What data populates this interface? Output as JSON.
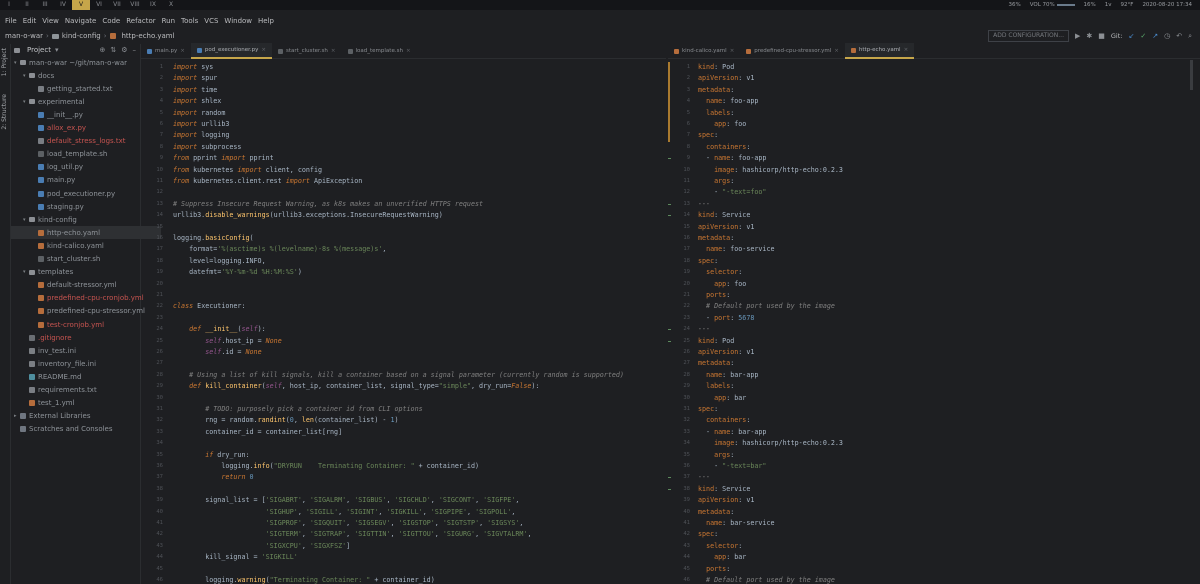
{
  "workspaces": [
    "I",
    "II",
    "III",
    "IV",
    "V",
    "VI",
    "VII",
    "VIII",
    "IX",
    "X"
  ],
  "active_workspace": 4,
  "status": [
    "36%",
    "VOL 70%",
    "16%",
    "1v",
    "92°F",
    "2020-08-20 17:34"
  ],
  "menu": [
    "File",
    "Edit",
    "View",
    "Navigate",
    "Code",
    "Refactor",
    "Run",
    "Tools",
    "VCS",
    "Window",
    "Help"
  ],
  "breadcrumb": [
    "man-o-war",
    "kind-config",
    "http-echo.yaml"
  ],
  "run_config": "ADD CONFIGURATION...",
  "git_label": "Git:",
  "side_tabs": [
    "1: Project",
    "2: Structure"
  ],
  "project_title": "Project",
  "tree": [
    {
      "label": "man-o-war ~/git/man-o-war",
      "depth": 0,
      "type": "folder",
      "open": true
    },
    {
      "label": "docs",
      "depth": 1,
      "type": "folder",
      "open": true
    },
    {
      "label": "getting_started.txt",
      "depth": 2,
      "type": "txt"
    },
    {
      "label": "experimental",
      "depth": 1,
      "type": "folder",
      "open": true
    },
    {
      "label": "__init__.py",
      "depth": 2,
      "type": "py"
    },
    {
      "label": "allox_ex.py",
      "depth": 2,
      "type": "py",
      "red": true
    },
    {
      "label": "default_stress_logs.txt",
      "depth": 2,
      "type": "txt",
      "red": true
    },
    {
      "label": "load_template.sh",
      "depth": 2,
      "type": "sh"
    },
    {
      "label": "log_util.py",
      "depth": 2,
      "type": "py"
    },
    {
      "label": "main.py",
      "depth": 2,
      "type": "py"
    },
    {
      "label": "pod_executioner.py",
      "depth": 2,
      "type": "py"
    },
    {
      "label": "staging.py",
      "depth": 2,
      "type": "py"
    },
    {
      "label": "kind-config",
      "depth": 1,
      "type": "folder",
      "open": true
    },
    {
      "label": "http-echo.yaml",
      "depth": 2,
      "type": "yaml",
      "selected": true
    },
    {
      "label": "kind-calico.yaml",
      "depth": 2,
      "type": "yaml"
    },
    {
      "label": "start_cluster.sh",
      "depth": 2,
      "type": "sh"
    },
    {
      "label": "templates",
      "depth": 1,
      "type": "folder",
      "open": true
    },
    {
      "label": "default-stressor.yml",
      "depth": 2,
      "type": "yaml"
    },
    {
      "label": "predefined-cpu-cronjob.yml",
      "depth": 2,
      "type": "yaml",
      "red": true
    },
    {
      "label": "predefined-cpu-stressor.yml",
      "depth": 2,
      "type": "yaml"
    },
    {
      "label": "test-cronjob.yml",
      "depth": 2,
      "type": "yaml",
      "red": true
    },
    {
      "label": ".gitignore",
      "depth": 1,
      "type": "ignore",
      "red": true
    },
    {
      "label": "inv_test.ini",
      "depth": 1,
      "type": "ini"
    },
    {
      "label": "inventory_file.ini",
      "depth": 1,
      "type": "ini"
    },
    {
      "label": "README.md",
      "depth": 1,
      "type": "md"
    },
    {
      "label": "requirements.txt",
      "depth": 1,
      "type": "txt"
    },
    {
      "label": "test_1.yml",
      "depth": 1,
      "type": "yaml"
    },
    {
      "label": "External Libraries",
      "depth": 0,
      "type": "lib",
      "closed": true
    },
    {
      "label": "Scratches and Consoles",
      "depth": 0,
      "type": "lib"
    }
  ],
  "left_tabs": [
    "main.py",
    "pod_executioner.py",
    "start_cluster.sh",
    "load_template.sh"
  ],
  "left_active_tab": 1,
  "right_tabs": [
    "kind-calico.yaml",
    "predefined-cpu-stressor.yml",
    "http-echo.yaml"
  ],
  "right_active_tab": 2,
  "python_code": [
    [
      [
        "kw",
        "import"
      ],
      [
        "t",
        " sys"
      ]
    ],
    [
      [
        "kw",
        "import"
      ],
      [
        "t",
        " spur"
      ]
    ],
    [
      [
        "kw",
        "import"
      ],
      [
        "t",
        " time"
      ]
    ],
    [
      [
        "kw",
        "import"
      ],
      [
        "t",
        " shlex"
      ]
    ],
    [
      [
        "kw",
        "import"
      ],
      [
        "t",
        " random"
      ]
    ],
    [
      [
        "kw",
        "import"
      ],
      [
        "t",
        " urllib3"
      ]
    ],
    [
      [
        "kw",
        "import"
      ],
      [
        "t",
        " logging"
      ]
    ],
    [
      [
        "kw",
        "import"
      ],
      [
        "t",
        " subprocess"
      ]
    ],
    [
      [
        "kw",
        "from"
      ],
      [
        "t",
        " pprint "
      ],
      [
        "kw",
        "import"
      ],
      [
        "t",
        " pprint"
      ]
    ],
    [
      [
        "kw",
        "from"
      ],
      [
        "t",
        " kubernetes "
      ],
      [
        "kw",
        "import"
      ],
      [
        "t",
        " client, config"
      ]
    ],
    [
      [
        "kw",
        "from"
      ],
      [
        "t",
        " kubernetes.client.rest "
      ],
      [
        "kw",
        "import"
      ],
      [
        "t",
        " ApiException"
      ]
    ],
    [],
    [
      [
        "cmt",
        "# Suppress Insecure Request Warning, as k8s makes an unverified HTTPS request"
      ]
    ],
    [
      [
        "t",
        "urllib3."
      ],
      [
        "fn",
        "disable_warnings"
      ],
      [
        "t",
        "(urllib3.exceptions.InsecureRequestWarning)"
      ]
    ],
    [],
    [
      [
        "t",
        "logging."
      ],
      [
        "fn",
        "basicConfig"
      ],
      [
        "t",
        "("
      ]
    ],
    [
      [
        "t",
        "    format="
      ],
      [
        "str",
        "'%(asctime)s %(levelname)-8s %(message)s'"
      ],
      [
        "t",
        ","
      ]
    ],
    [
      [
        "t",
        "    level=logging.INFO,"
      ]
    ],
    [
      [
        "t",
        "    datefmt="
      ],
      [
        "str",
        "'%Y-%m-%d %H:%M:%S'"
      ],
      [
        "t",
        ")"
      ]
    ],
    [],
    [],
    [
      [
        "kw",
        "class"
      ],
      [
        "t",
        " Executioner:"
      ]
    ],
    [],
    [
      [
        "t",
        "    "
      ],
      [
        "kw",
        "def"
      ],
      [
        "t",
        " "
      ],
      [
        "fn",
        "__init__"
      ],
      [
        "t",
        "("
      ],
      [
        "self",
        "self"
      ],
      [
        "t",
        "):"
      ]
    ],
    [
      [
        "t",
        "        "
      ],
      [
        "self",
        "self"
      ],
      [
        "t",
        ".host_ip = "
      ],
      [
        "kw",
        "None"
      ]
    ],
    [
      [
        "t",
        "        "
      ],
      [
        "self",
        "self"
      ],
      [
        "t",
        ".id = "
      ],
      [
        "kw",
        "None"
      ]
    ],
    [],
    [
      [
        "cmt",
        "    # Using a list of kill signals, kill a container based on a signal parameter (currently random is supported)"
      ]
    ],
    [
      [
        "t",
        "    "
      ],
      [
        "kw",
        "def"
      ],
      [
        "t",
        " "
      ],
      [
        "fn",
        "kill_container"
      ],
      [
        "t",
        "("
      ],
      [
        "self",
        "self"
      ],
      [
        "t",
        ", host_ip, container_list, signal_type="
      ],
      [
        "str",
        "\"simple\""
      ],
      [
        "t",
        ", dry_run="
      ],
      [
        "kw",
        "False"
      ],
      [
        "t",
        "):"
      ]
    ],
    [],
    [
      [
        "cmt",
        "        # TODO: purposely pick a container id from CLI options"
      ]
    ],
    [
      [
        "t",
        "        rng = random."
      ],
      [
        "fn",
        "randint"
      ],
      [
        "t",
        "("
      ],
      [
        "num",
        "0"
      ],
      [
        "t",
        ", "
      ],
      [
        "fn",
        "len"
      ],
      [
        "t",
        "(container_list) - "
      ],
      [
        "num",
        "1"
      ],
      [
        "t",
        ")"
      ]
    ],
    [
      [
        "t",
        "        container_id = container_list[rng]"
      ]
    ],
    [],
    [
      [
        "t",
        "        "
      ],
      [
        "kw",
        "if"
      ],
      [
        "t",
        " dry_run:"
      ]
    ],
    [
      [
        "t",
        "            logging."
      ],
      [
        "fn",
        "info"
      ],
      [
        "t",
        "("
      ],
      [
        "str",
        "\"DRYRUN    Terminating Container: \""
      ],
      [
        "t",
        " + container_id)"
      ]
    ],
    [
      [
        "t",
        "            "
      ],
      [
        "kw",
        "return"
      ],
      [
        "t",
        " "
      ],
      [
        "num",
        "0"
      ]
    ],
    [],
    [
      [
        "t",
        "        signal_list = ["
      ],
      [
        "str",
        "'SIGABRT'"
      ],
      [
        "t",
        ", "
      ],
      [
        "str",
        "'SIGALRM'"
      ],
      [
        "t",
        ", "
      ],
      [
        "str",
        "'SIGBUS'"
      ],
      [
        "t",
        ", "
      ],
      [
        "str",
        "'SIGCHLD'"
      ],
      [
        "t",
        ", "
      ],
      [
        "str",
        "'SIGCONT'"
      ],
      [
        "t",
        ", "
      ],
      [
        "str",
        "'SIGFPE'"
      ],
      [
        "t",
        ","
      ]
    ],
    [
      [
        "t",
        "                       "
      ],
      [
        "str",
        "'SIGHUP'"
      ],
      [
        "t",
        ", "
      ],
      [
        "str",
        "'SIGILL'"
      ],
      [
        "t",
        ", "
      ],
      [
        "str",
        "'SIGINT'"
      ],
      [
        "t",
        ", "
      ],
      [
        "str",
        "'SIGKILL'"
      ],
      [
        "t",
        ", "
      ],
      [
        "str",
        "'SIGPIPE'"
      ],
      [
        "t",
        ", "
      ],
      [
        "str",
        "'SIGPOLL'"
      ],
      [
        "t",
        ","
      ]
    ],
    [
      [
        "t",
        "                       "
      ],
      [
        "str",
        "'SIGPROF'"
      ],
      [
        "t",
        ", "
      ],
      [
        "str",
        "'SIGQUIT'"
      ],
      [
        "t",
        ", "
      ],
      [
        "str",
        "'SIGSEGV'"
      ],
      [
        "t",
        ", "
      ],
      [
        "str",
        "'SIGSTOP'"
      ],
      [
        "t",
        ", "
      ],
      [
        "str",
        "'SIGTSTP'"
      ],
      [
        "t",
        ", "
      ],
      [
        "str",
        "'SIGSYS'"
      ],
      [
        "t",
        ","
      ]
    ],
    [
      [
        "t",
        "                       "
      ],
      [
        "str",
        "'SIGTERM'"
      ],
      [
        "t",
        ", "
      ],
      [
        "str",
        "'SIGTRAP'"
      ],
      [
        "t",
        ", "
      ],
      [
        "str",
        "'SIGTTIN'"
      ],
      [
        "t",
        ", "
      ],
      [
        "str",
        "'SIGTTOU'"
      ],
      [
        "t",
        ", "
      ],
      [
        "str",
        "'SIGURG'"
      ],
      [
        "t",
        ", "
      ],
      [
        "str",
        "'SIGVTALRM'"
      ],
      [
        "t",
        ","
      ]
    ],
    [
      [
        "t",
        "                       "
      ],
      [
        "str",
        "'SIGXCPU'"
      ],
      [
        "t",
        ", "
      ],
      [
        "str",
        "'SIGXFSZ'"
      ],
      [
        "t",
        "]"
      ]
    ],
    [
      [
        "t",
        "        kill_signal = "
      ],
      [
        "str",
        "'SIGKILL'"
      ]
    ],
    [],
    [
      [
        "t",
        "        logging."
      ],
      [
        "fn",
        "warning"
      ],
      [
        "t",
        "("
      ],
      [
        "str",
        "\"Terminating Container: \""
      ],
      [
        "t",
        " + container_id)"
      ]
    ]
  ],
  "yaml_code": [
    [
      [
        "yk",
        "kind"
      ],
      [
        "yv",
        ": Pod"
      ]
    ],
    [
      [
        "yk",
        "apiVersion"
      ],
      [
        "yv",
        ": v1"
      ]
    ],
    [
      [
        "yk",
        "metadata"
      ],
      [
        "yv",
        ":"
      ]
    ],
    [
      [
        "yv",
        "  "
      ],
      [
        "yk",
        "name"
      ],
      [
        "yv",
        ": foo-app"
      ]
    ],
    [
      [
        "yv",
        "  "
      ],
      [
        "yk",
        "labels"
      ],
      [
        "yv",
        ":"
      ]
    ],
    [
      [
        "yv",
        "    "
      ],
      [
        "yk",
        "app"
      ],
      [
        "yv",
        ": foo"
      ]
    ],
    [
      [
        "yk",
        "spec"
      ],
      [
        "yv",
        ":"
      ]
    ],
    [
      [
        "yv",
        "  "
      ],
      [
        "yk",
        "containers"
      ],
      [
        "yv",
        ":"
      ]
    ],
    [
      [
        "yv",
        "  - "
      ],
      [
        "yk",
        "name"
      ],
      [
        "yv",
        ": foo-app"
      ]
    ],
    [
      [
        "yv",
        "    "
      ],
      [
        "yk",
        "image"
      ],
      [
        "yv",
        ": hashicorp/http-echo:0.2.3"
      ]
    ],
    [
      [
        "yv",
        "    "
      ],
      [
        "yk",
        "args"
      ],
      [
        "yv",
        ":"
      ]
    ],
    [
      [
        "yv",
        "    - "
      ],
      [
        "ys",
        "\"-text=foo\""
      ]
    ],
    [
      [
        "cmt",
        "---"
      ]
    ],
    [
      [
        "yk",
        "kind"
      ],
      [
        "yv",
        ": Service"
      ]
    ],
    [
      [
        "yk",
        "apiVersion"
      ],
      [
        "yv",
        ": v1"
      ]
    ],
    [
      [
        "yk",
        "metadata"
      ],
      [
        "yv",
        ":"
      ]
    ],
    [
      [
        "yv",
        "  "
      ],
      [
        "yk",
        "name"
      ],
      [
        "yv",
        ": foo-service"
      ]
    ],
    [
      [
        "yk",
        "spec"
      ],
      [
        "yv",
        ":"
      ]
    ],
    [
      [
        "yv",
        "  "
      ],
      [
        "yk",
        "selector"
      ],
      [
        "yv",
        ":"
      ]
    ],
    [
      [
        "yv",
        "    "
      ],
      [
        "yk",
        "app"
      ],
      [
        "yv",
        ": foo"
      ]
    ],
    [
      [
        "yv",
        "  "
      ],
      [
        "yk",
        "ports"
      ],
      [
        "yv",
        ":"
      ]
    ],
    [
      [
        "cmt",
        "  # Default port used by the image"
      ]
    ],
    [
      [
        "yv",
        "  - "
      ],
      [
        "yk",
        "port"
      ],
      [
        "yv",
        ": "
      ],
      [
        "yn",
        "5678"
      ]
    ],
    [
      [
        "cmt",
        "---"
      ]
    ],
    [
      [
        "yk",
        "kind"
      ],
      [
        "yv",
        ": Pod"
      ]
    ],
    [
      [
        "yk",
        "apiVersion"
      ],
      [
        "yv",
        ": v1"
      ]
    ],
    [
      [
        "yk",
        "metadata"
      ],
      [
        "yv",
        ":"
      ]
    ],
    [
      [
        "yv",
        "  "
      ],
      [
        "yk",
        "name"
      ],
      [
        "yv",
        ": bar-app"
      ]
    ],
    [
      [
        "yv",
        "  "
      ],
      [
        "yk",
        "labels"
      ],
      [
        "yv",
        ":"
      ]
    ],
    [
      [
        "yv",
        "    "
      ],
      [
        "yk",
        "app"
      ],
      [
        "yv",
        ": bar"
      ]
    ],
    [
      [
        "yk",
        "spec"
      ],
      [
        "yv",
        ":"
      ]
    ],
    [
      [
        "yv",
        "  "
      ],
      [
        "yk",
        "containers"
      ],
      [
        "yv",
        ":"
      ]
    ],
    [
      [
        "yv",
        "  - "
      ],
      [
        "yk",
        "name"
      ],
      [
        "yv",
        ": bar-app"
      ]
    ],
    [
      [
        "yv",
        "    "
      ],
      [
        "yk",
        "image"
      ],
      [
        "yv",
        ": hashicorp/http-echo:0.2.3"
      ]
    ],
    [
      [
        "yv",
        "    "
      ],
      [
        "yk",
        "args"
      ],
      [
        "yv",
        ":"
      ]
    ],
    [
      [
        "yv",
        "    - "
      ],
      [
        "ys",
        "\"-text=bar\""
      ]
    ],
    [
      [
        "cmt",
        "---"
      ]
    ],
    [
      [
        "yk",
        "kind"
      ],
      [
        "yv",
        ": Service"
      ]
    ],
    [
      [
        "yk",
        "apiVersion"
      ],
      [
        "yv",
        ": v1"
      ]
    ],
    [
      [
        "yk",
        "metadata"
      ],
      [
        "yv",
        ":"
      ]
    ],
    [
      [
        "yv",
        "  "
      ],
      [
        "yk",
        "name"
      ],
      [
        "yv",
        ": bar-service"
      ]
    ],
    [
      [
        "yk",
        "spec"
      ],
      [
        "yv",
        ":"
      ]
    ],
    [
      [
        "yv",
        "  "
      ],
      [
        "yk",
        "selector"
      ],
      [
        "yv",
        ":"
      ]
    ],
    [
      [
        "yv",
        "    "
      ],
      [
        "yk",
        "app"
      ],
      [
        "yv",
        ": bar"
      ]
    ],
    [
      [
        "yv",
        "  "
      ],
      [
        "yk",
        "ports"
      ],
      [
        "yv",
        ":"
      ]
    ],
    [
      [
        "cmt",
        "  # Default port used by the image"
      ]
    ]
  ]
}
